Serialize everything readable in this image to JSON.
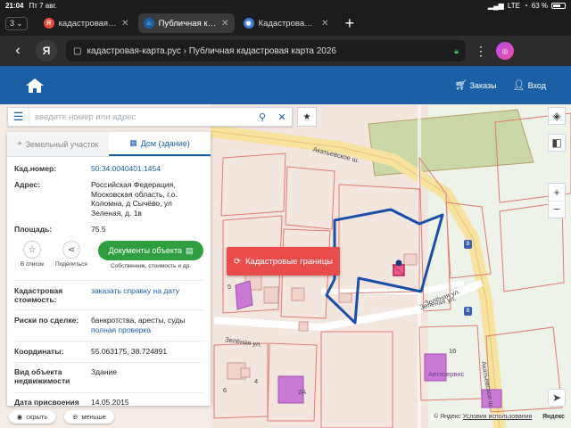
{
  "status_bar": {
    "time": "21:04",
    "date": "Пт 7 авг.",
    "network": "LTE",
    "battery": "63 %"
  },
  "tabs": {
    "count": "3",
    "items": [
      {
        "label": "кадастровая ка",
        "favicon": "Я",
        "color": "#e84b3c",
        "active": false
      },
      {
        "label": "Публичная када",
        "favicon": "⌂",
        "color": "#1b5fa6",
        "active": true
      },
      {
        "label": "Кадастровая кар",
        "favicon": "◉",
        "color": "#3f7ad9",
        "active": false
      }
    ]
  },
  "address_bar": {
    "url": "кадастровая-карта.рус › Публичная кадастровая карта 2026",
    "yandex_button": "Я"
  },
  "site_header": {
    "orders_label": "Заказы",
    "login_label": "Вход"
  },
  "search": {
    "placeholder": "введите номер или адрес"
  },
  "panel": {
    "tab_land": "Земельный участок",
    "tab_building": "Дом (здание)",
    "cad_number_label": "Кад.номер:",
    "cad_number": "50:34:0040401:1454",
    "address_label": "Адрес:",
    "address": "Российская Федерация, Московская область, г.о. Коломна, д Сычёво, ул Зеленая, д. 1в",
    "area_label": "Площадь:",
    "area": "75.5",
    "action_list": "В список",
    "action_share": "Поделиться",
    "docs_button": "Документы объекта",
    "docs_sub": "Собственник, стоимость и др.",
    "cad_value_label": "Кадастровая стоимость:",
    "cad_value_link": "заказать справку на дату",
    "risks_label": "Риски по сделке:",
    "risks_text": "банкротства, аресты, суды",
    "risks_link": "полная проверка",
    "coords_label": "Координаты:",
    "coords": "55.063175, 38.724891",
    "type_label": "Вид объекта недвижимости",
    "type_value": "Здание",
    "date_label": "Дата присвоения",
    "date_value": "14.05.2015"
  },
  "map": {
    "boundaries_button": "Кадастровые границы",
    "street_main": "Акатьевское ш.",
    "street_main2": "Акатьевское ш.",
    "street_green": "Зеленая ул.",
    "street_green2": "Зелёная ул.",
    "street_green3": "Зелёная ул.",
    "house_5": "5",
    "house_6": "6",
    "house_4": "4",
    "house_2a": "2А",
    "house_16": "16",
    "poi_label": "Автосервис",
    "bus_stop": "B"
  },
  "bottom": {
    "hide_label": "скрыть",
    "less_label": "меньше",
    "copyright": "© Яндекс",
    "terms_link": "Условия использования",
    "logo": "Яндекс"
  }
}
